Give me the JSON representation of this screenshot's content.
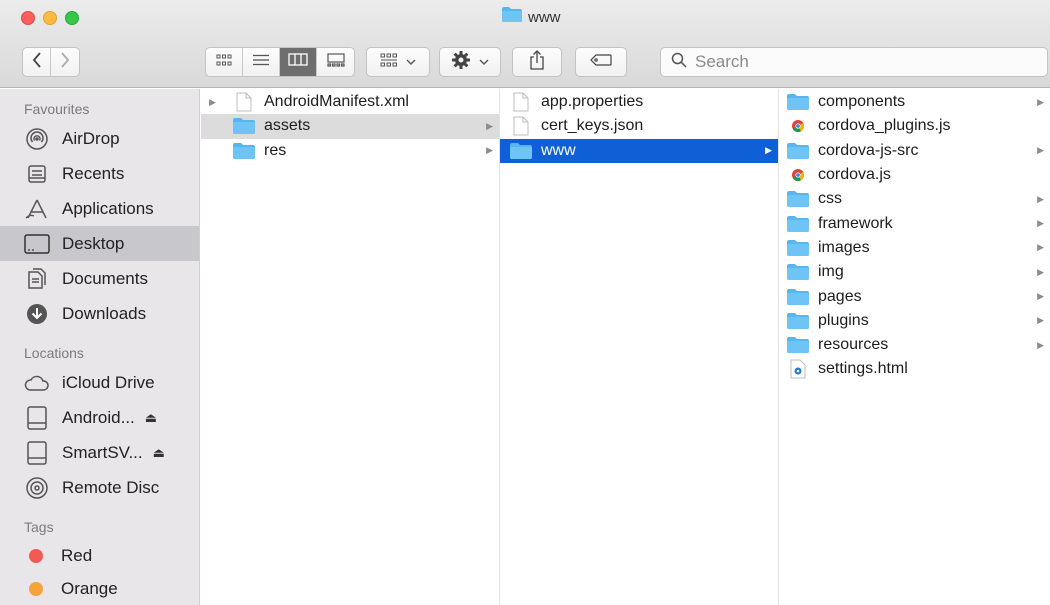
{
  "window": {
    "title": "www",
    "colors": {
      "selection_blue": "#0f5fd6",
      "folder_blue": "#57b6ee"
    }
  },
  "toolbar": {
    "back_icon": "chevron-left-icon",
    "forward_icon": "chevron-right-icon",
    "view_modes": [
      "icon-view-icon",
      "list-view-icon",
      "column-view-icon",
      "gallery-view-icon"
    ],
    "active_view": "column-view-icon",
    "group_icon": "group-by-icon",
    "action_icon": "gear-icon",
    "share_icon": "share-icon",
    "tag_icon": "tag-icon",
    "search": {
      "placeholder": "Search",
      "value": ""
    }
  },
  "sidebar": {
    "favourites_header": "Favourites",
    "favourites": [
      {
        "label": "AirDrop",
        "icon": "airdrop-icon"
      },
      {
        "label": "Recents",
        "icon": "recents-icon"
      },
      {
        "label": "Applications",
        "icon": "applications-icon"
      },
      {
        "label": "Desktop",
        "icon": "desktop-icon",
        "selected": true
      },
      {
        "label": "Documents",
        "icon": "documents-icon"
      },
      {
        "label": "Downloads",
        "icon": "downloads-icon"
      }
    ],
    "locations_header": "Locations",
    "locations": [
      {
        "label": "iCloud Drive",
        "icon": "icloud-icon"
      },
      {
        "label": "Android...",
        "icon": "disk-icon",
        "eject": "⏏"
      },
      {
        "label": "SmartSV...",
        "icon": "disk-icon",
        "eject": "⏏"
      },
      {
        "label": "Remote Disc",
        "icon": "remote-disc-icon"
      }
    ],
    "tags_header": "Tags",
    "tags": [
      {
        "label": "Red",
        "color": "#f25a53"
      },
      {
        "label": "Orange",
        "color": "#f5a33b"
      }
    ]
  },
  "columns": {
    "col1": [
      {
        "name": "AndroidManifest.xml",
        "kind": "file",
        "disclosure": "▶"
      },
      {
        "name": "assets",
        "kind": "folder",
        "chevron": "▶",
        "state": "path"
      },
      {
        "name": "res",
        "kind": "folder",
        "chevron": "▶"
      }
    ],
    "col2": [
      {
        "name": "app.properties",
        "kind": "file"
      },
      {
        "name": "cert_keys.json",
        "kind": "file"
      },
      {
        "name": "www",
        "kind": "folder",
        "chevron": "▶",
        "state": "selected"
      }
    ],
    "col3": [
      {
        "name": "components",
        "kind": "folder",
        "chevron": "▶"
      },
      {
        "name": "cordova_plugins.js",
        "kind": "chrome"
      },
      {
        "name": "cordova-js-src",
        "kind": "folder",
        "chevron": "▶"
      },
      {
        "name": "cordova.js",
        "kind": "chrome"
      },
      {
        "name": "css",
        "kind": "folder",
        "chevron": "▶"
      },
      {
        "name": "framework",
        "kind": "folder",
        "chevron": "▶"
      },
      {
        "name": "images",
        "kind": "folder",
        "chevron": "▶"
      },
      {
        "name": "img",
        "kind": "folder",
        "chevron": "▶"
      },
      {
        "name": "pages",
        "kind": "folder",
        "chevron": "▶"
      },
      {
        "name": "plugins",
        "kind": "folder",
        "chevron": "▶"
      },
      {
        "name": "resources",
        "kind": "folder",
        "chevron": "▶"
      },
      {
        "name": "settings.html",
        "kind": "html"
      }
    ]
  }
}
